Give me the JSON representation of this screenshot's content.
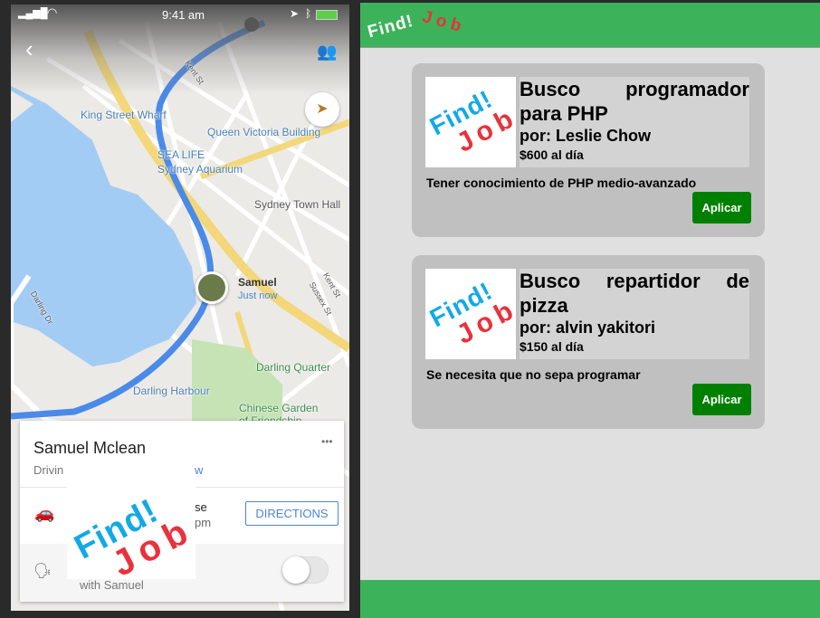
{
  "phone": {
    "status": {
      "time": "9:41 am"
    },
    "map_labels": {
      "king_street_wharf": "King Street Wharf",
      "queen_victoria": "Queen Victoria Building",
      "sea_life_1": "SEA LIFE",
      "sea_life_2": "Sydney Aquarium",
      "town_hall": "Sydney Town Hall",
      "kent_st": "Kent St",
      "kent_st_2": "Kent St",
      "sussex_st": "Sussex St",
      "darling_dr": "Darling Dr",
      "darling_quarter": "Darling Quarter",
      "darling_harbour": "Darling Harbour",
      "chinese_garden": "Chinese Garden",
      "chinese_garden_2": "of Friendship"
    },
    "marker": {
      "name": "Samuel",
      "status": "Just now"
    },
    "card": {
      "name": "Samuel Mclean",
      "subtitle_left": "Drivin",
      "subtitle_right": "w",
      "more": "•••",
      "eta_right_1": "se",
      "eta_right_2": "pm",
      "directions_label": "DIRECTIONS",
      "share_text": "with Samuel"
    },
    "overlay_logo": {
      "line1": "Find!",
      "line2": "Job"
    }
  },
  "web": {
    "header_logo": {
      "line1": "Find!",
      "line2": "Job"
    },
    "jobs": [
      {
        "title": "Busco programador para PHP",
        "author": "por: Leslie Chow",
        "pay": "$600 al día",
        "description": "Tener conocimiento de PHP medio-avanzado",
        "apply_label": "Aplicar",
        "logo1": "Find!",
        "logo2": "Job"
      },
      {
        "title": "Busco repartidor de pizza",
        "author": "por: alvin yakitori",
        "pay": "$150 al día",
        "description": "Se necesita que no sepa programar",
        "apply_label": "Aplicar",
        "logo1": "Find!",
        "logo2": "Job"
      }
    ]
  },
  "colors": {
    "green": "#3cb35a",
    "apply": "#008000",
    "logo_blue": "#12a9e6",
    "logo_red": "#e8323c",
    "route": "#4a8ae8"
  }
}
